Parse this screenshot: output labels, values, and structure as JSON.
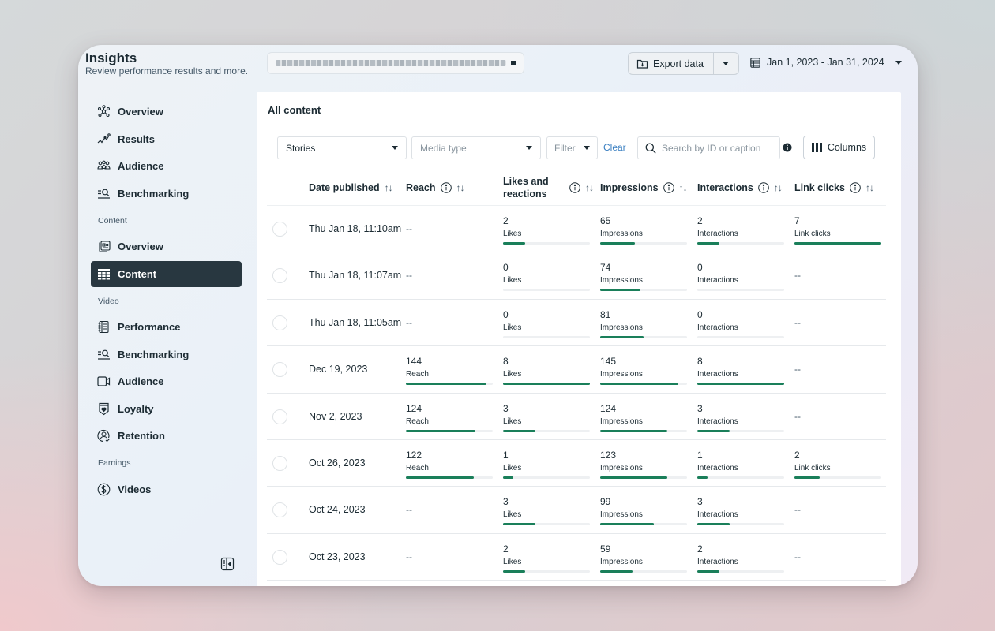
{
  "header": {
    "title": "Insights",
    "subtitle": "Review performance results and more.",
    "account_selector": {
      "value": "[redacted account name]"
    },
    "export_label": "Export data",
    "date_range": "Jan 1, 2023 - Jan 31, 2024"
  },
  "sidebar": {
    "items": [
      {
        "label": "Overview",
        "icon": "nodes-icon"
      },
      {
        "label": "Results",
        "icon": "trend-icon"
      },
      {
        "label": "Audience",
        "icon": "people-icon"
      },
      {
        "label": "Benchmarking",
        "icon": "benchmark-icon"
      }
    ],
    "sections": [
      {
        "title": "Content",
        "items": [
          {
            "label": "Overview",
            "icon": "content-overview-icon"
          },
          {
            "label": "Content",
            "icon": "table-icon",
            "active": true
          }
        ]
      },
      {
        "title": "Video",
        "items": [
          {
            "label": "Performance",
            "icon": "notebook-icon"
          },
          {
            "label": "Benchmarking",
            "icon": "benchmark-icon"
          },
          {
            "label": "Audience",
            "icon": "video-camera-icon"
          },
          {
            "label": "Loyalty",
            "icon": "heart-shield-icon"
          },
          {
            "label": "Retention",
            "icon": "user-check-icon"
          }
        ]
      },
      {
        "title": "Earnings",
        "items": [
          {
            "label": "Videos",
            "icon": "dollar-icon"
          }
        ]
      }
    ]
  },
  "main": {
    "title": "All content",
    "filters": {
      "content_type": "Stories",
      "media_type_placeholder": "Media type",
      "filter_label": "Filter",
      "clear_label": "Clear",
      "search_placeholder": "Search by ID or caption",
      "columns_label": "Columns"
    },
    "table": {
      "columns": [
        {
          "label": "Date published",
          "info": false
        },
        {
          "label": "Reach",
          "info": true
        },
        {
          "label": "Likes and reactions",
          "info": true
        },
        {
          "label": "Impressions",
          "info": true
        },
        {
          "label": "Interactions",
          "info": true
        },
        {
          "label": "Link clicks",
          "info": true
        }
      ],
      "units": {
        "reach": "Reach",
        "likes": "Likes",
        "impressions": "Impressions",
        "interactions": "Interactions",
        "link_clicks": "Link clicks"
      },
      "empty": "--",
      "rows": [
        {
          "date": "Thu Jan 18, 11:10am",
          "reach": null,
          "likes": 2,
          "impressions": 65,
          "interactions": 2,
          "link_clicks": 7,
          "bars": {
            "likes": 0.25,
            "impressions": 0.4,
            "interactions": 0.25,
            "link_clicks": 1.0
          }
        },
        {
          "date": "Thu Jan 18, 11:07am",
          "reach": null,
          "likes": 0,
          "impressions": 74,
          "interactions": 0,
          "link_clicks": null,
          "bars": {
            "likes": 0,
            "impressions": 0.46,
            "interactions": 0
          }
        },
        {
          "date": "Thu Jan 18, 11:05am",
          "reach": null,
          "likes": 0,
          "impressions": 81,
          "interactions": 0,
          "link_clicks": null,
          "bars": {
            "likes": 0,
            "impressions": 0.5,
            "interactions": 0
          }
        },
        {
          "date": "Dec 19, 2023",
          "reach": 144,
          "likes": 8,
          "impressions": 145,
          "interactions": 8,
          "link_clicks": null,
          "bars": {
            "reach": 0.93,
            "likes": 1.0,
            "impressions": 0.9,
            "interactions": 1.0
          }
        },
        {
          "date": "Nov 2, 2023",
          "reach": 124,
          "likes": 3,
          "impressions": 124,
          "interactions": 3,
          "link_clicks": null,
          "bars": {
            "reach": 0.8,
            "likes": 0.37,
            "impressions": 0.77,
            "interactions": 0.37
          }
        },
        {
          "date": "Oct 26, 2023",
          "reach": 122,
          "likes": 1,
          "impressions": 123,
          "interactions": 1,
          "link_clicks": 2,
          "bars": {
            "reach": 0.78,
            "likes": 0.12,
            "impressions": 0.77,
            "interactions": 0.12,
            "link_clicks": 0.29
          }
        },
        {
          "date": "Oct 24, 2023",
          "reach": null,
          "likes": 3,
          "impressions": 99,
          "interactions": 3,
          "link_clicks": null,
          "bars": {
            "likes": 0.37,
            "impressions": 0.62,
            "interactions": 0.37
          }
        },
        {
          "date": "Oct 23, 2023",
          "reach": null,
          "likes": 2,
          "impressions": 59,
          "interactions": 2,
          "link_clicks": null,
          "bars": {
            "likes": 0.25,
            "impressions": 0.37,
            "interactions": 0.25
          }
        }
      ]
    }
  },
  "colors": {
    "accent_bar": "#1a7f5a",
    "active_nav": "#283740",
    "link": "#3a7fc1"
  }
}
